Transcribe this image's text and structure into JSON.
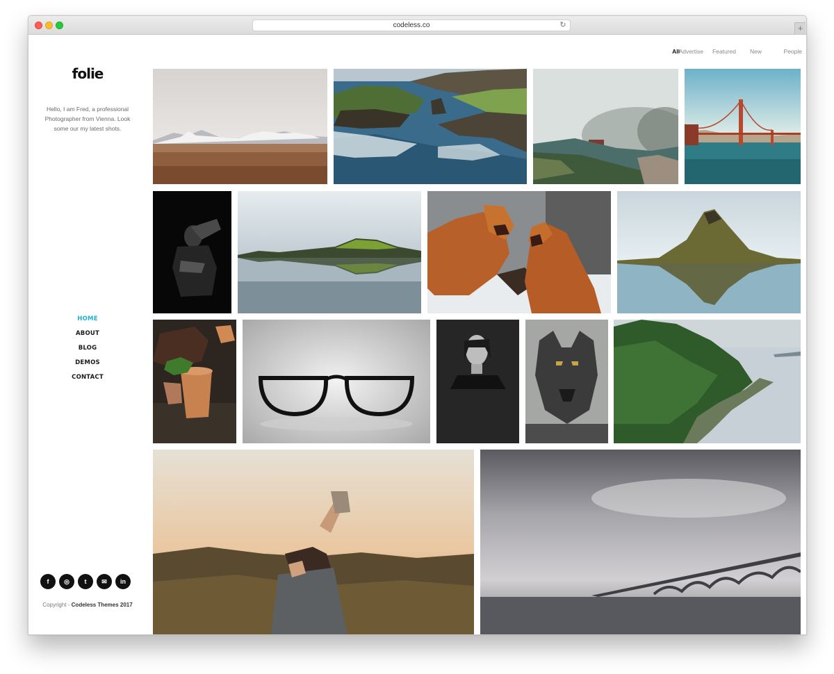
{
  "browser": {
    "url": "codeless.co",
    "new_tab_symbol": "+",
    "reload_symbol": "↻"
  },
  "sidebar": {
    "logo": "folie",
    "intro": "Hello, I am Fred, a professional Photographer from Vienna. Look some our my latest shots.",
    "nav": [
      "HOME",
      "ABOUT",
      "BLOG",
      "DEMOS",
      "CONTACT"
    ],
    "active_nav": "HOME",
    "social": [
      "facebook-icon",
      "instagram-icon",
      "twitter-icon",
      "mail-icon",
      "linkedin-icon"
    ],
    "social_glyphs": [
      "f",
      "◎",
      "t",
      "✉",
      "in"
    ],
    "copyright_prefix": "Copyright - ",
    "copyright_owner": "Codeless Themes 2017"
  },
  "filters": {
    "items": [
      "All",
      "Advertise",
      "Featured",
      "New",
      "People"
    ],
    "active": "All"
  },
  "gallery": {
    "photos": [
      "desert-mountains-photo",
      "coastal-cliffs-photo",
      "foggy-lake-photo",
      "golden-gate-bridge-photo",
      "dark-portrait-man-photo",
      "mountain-lake-reflection-photo",
      "fighting-foxes-photo",
      "kirkjufell-reflection-photo",
      "cocktail-glass-photo",
      "eyeglasses-photo",
      "woman-portrait-photo",
      "wolf-photo",
      "forest-coast-photo",
      "man-drinking-water-photo",
      "long-bridge-sea-photo"
    ]
  },
  "colors": {
    "accent": "#1fb0d0",
    "text": "#1a1a1a",
    "muted": "#8a8a8a"
  }
}
